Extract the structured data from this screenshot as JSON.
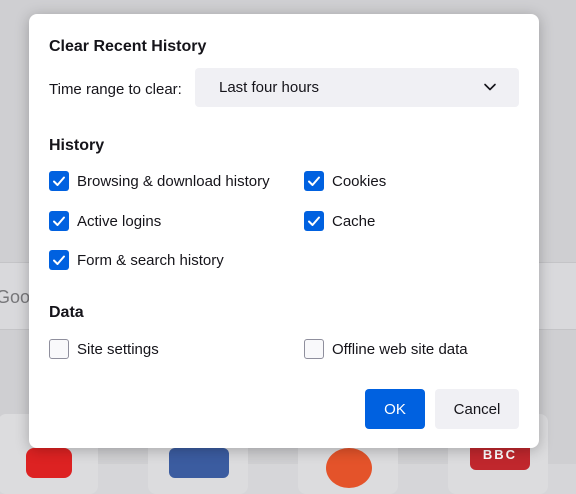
{
  "background": {
    "search_text": "Goog",
    "bbc_logo": "BBC"
  },
  "dialog": {
    "title": "Clear Recent History",
    "time_range_label": "Time range to clear:",
    "time_range_value": "Last four hours",
    "history_heading": "History",
    "history_items": [
      {
        "label": "Browsing & download history",
        "checked": true
      },
      {
        "label": "Cookies",
        "checked": true
      },
      {
        "label": "Active logins",
        "checked": true
      },
      {
        "label": "Cache",
        "checked": true
      },
      {
        "label": "Form & search history",
        "checked": true
      }
    ],
    "data_heading": "Data",
    "data_items": [
      {
        "label": "Site settings",
        "checked": false
      },
      {
        "label": "Offline web site data",
        "checked": false
      }
    ],
    "ok_label": "OK",
    "cancel_label": "Cancel"
  },
  "colors": {
    "accent": "#0061e0",
    "dialog_bg": "#ffffff",
    "select_bg": "#f0f0f4"
  }
}
